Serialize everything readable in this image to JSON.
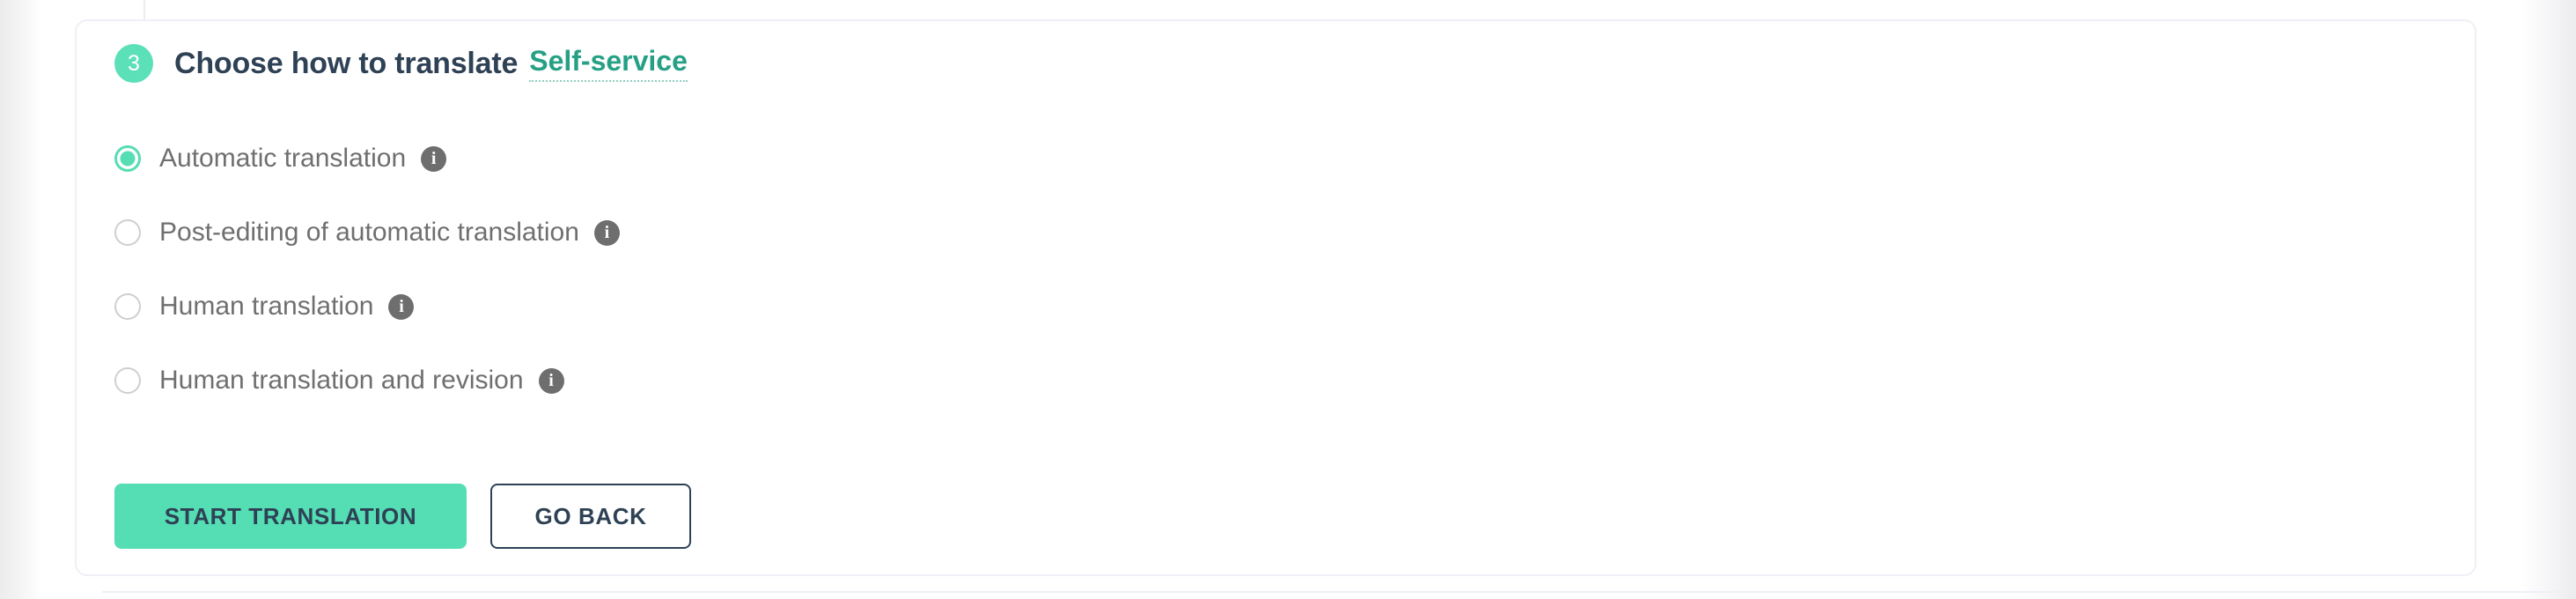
{
  "card": {
    "step_number": "3",
    "title": "Choose how to translate",
    "service_link": "Self-service",
    "options": [
      {
        "label": "Automatic translation",
        "info": "i",
        "selected": true
      },
      {
        "label": "Post-editing of automatic translation",
        "info": "i",
        "selected": false
      },
      {
        "label": "Human translation",
        "info": "i",
        "selected": false
      },
      {
        "label": "Human translation and revision",
        "info": "i",
        "selected": false
      }
    ],
    "actions": {
      "primary_label": "START TRANSLATION",
      "secondary_label": "GO BACK"
    }
  },
  "colors": {
    "accent_teal": "#55ddb4",
    "link_teal": "#26a085",
    "text_dark": "#2e4155",
    "text_gray": "#6f6f6f",
    "info_gray": "#6e6e6e",
    "border_light": "#f0eff6"
  }
}
